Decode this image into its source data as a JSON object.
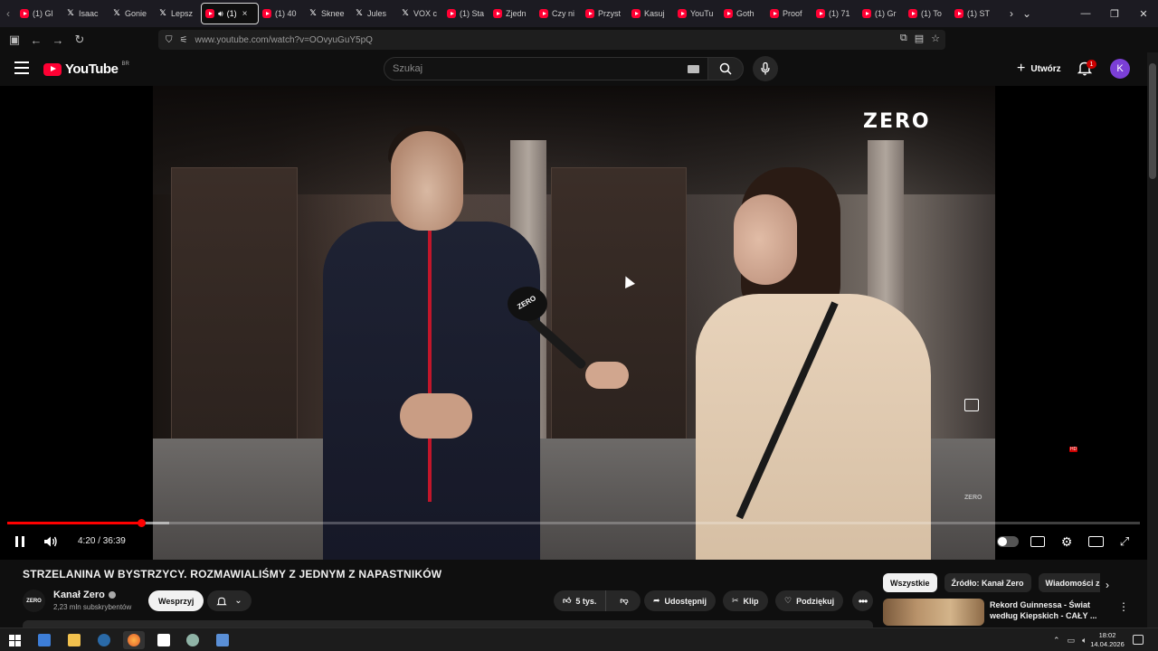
{
  "browser": {
    "tabs": [
      {
        "title": "(1) Gl",
        "favicon": "youtube-icon"
      },
      {
        "title": "Isaac",
        "favicon": "x-icon"
      },
      {
        "title": "Gonie",
        "favicon": "x-icon"
      },
      {
        "title": "Lepsz",
        "favicon": "x-icon"
      },
      {
        "title": "(1)",
        "favicon": "youtube-icon",
        "active": true,
        "audio": true
      },
      {
        "title": "(1) 40",
        "favicon": "youtube-icon"
      },
      {
        "title": "Sknee",
        "favicon": "x-icon"
      },
      {
        "title": "Jules",
        "favicon": "x-icon"
      },
      {
        "title": "VOX c",
        "favicon": "x-icon"
      },
      {
        "title": "(1) Sta",
        "favicon": "youtube-icon"
      },
      {
        "title": "Zjedn",
        "favicon": "youtube-icon"
      },
      {
        "title": "Czy ni",
        "favicon": "youtube-icon"
      },
      {
        "title": "Przyst",
        "favicon": "youtube-icon"
      },
      {
        "title": "Kasuj",
        "favicon": "youtube-icon"
      },
      {
        "title": "YouTu",
        "favicon": "youtube-icon"
      },
      {
        "title": "Goth",
        "favicon": "youtube-icon"
      },
      {
        "title": "Proof",
        "favicon": "youtube-icon"
      },
      {
        "title": "(1) 71",
        "favicon": "youtube-icon"
      },
      {
        "title": "(1) Gr",
        "favicon": "youtube-icon"
      },
      {
        "title": "(1) To",
        "favicon": "youtube-icon"
      },
      {
        "title": "(1) ST",
        "favicon": "youtube-icon"
      }
    ],
    "tab_close_glyph": "×",
    "url": "www.youtube.com/watch?v=OOvyuGuY5pQ"
  },
  "youtube": {
    "logo_text": "YouTube",
    "country_code": "BR",
    "search_placeholder": "Szukaj",
    "create_label": "Utwórz",
    "notification_count": "1",
    "avatar_letter": "K"
  },
  "player": {
    "watermark": "ZERO",
    "watermark_small": "ZERO",
    "mic_brand": "ZERO",
    "current_time": "4:20",
    "duration": "36:39",
    "time_display": "4:20 / 36:39",
    "progress_played": 0.1182,
    "progress_loaded": 0.143,
    "hd_badge": "HD"
  },
  "video": {
    "title": "STRZELANINA W BYSTRZYCY. ROZMAWIALIŚMY Z JEDNYM Z NAPASTNIKÓW",
    "channel_name": "Kanał Zero",
    "channel_avatar_text": "ZERO",
    "subscribers": "2,23 mln subskrybentów",
    "support_label": "Wesprzyj",
    "likes": "5 tys.",
    "share_label": "Udostępnij",
    "clip_label": "Klip",
    "thanks_label": "Podziękuj"
  },
  "sidebar": {
    "chips": [
      {
        "label": "Wszystkie",
        "active": true
      },
      {
        "label": "Źródło: Kanał Zero",
        "active": false
      },
      {
        "label": "Wiadomości z",
        "active": false
      }
    ],
    "recommendation": {
      "title": "Rekord Guinnessa - Świat według Kiepskich - CAŁY ..."
    }
  },
  "taskbar": {
    "time": "18:02",
    "date": "14.04.2026"
  },
  "colors": {
    "youtube_red": "#ff0033",
    "progress_red": "#ff0000",
    "avatar_purple": "#7b3fd6",
    "background": "#0f0f0f"
  }
}
